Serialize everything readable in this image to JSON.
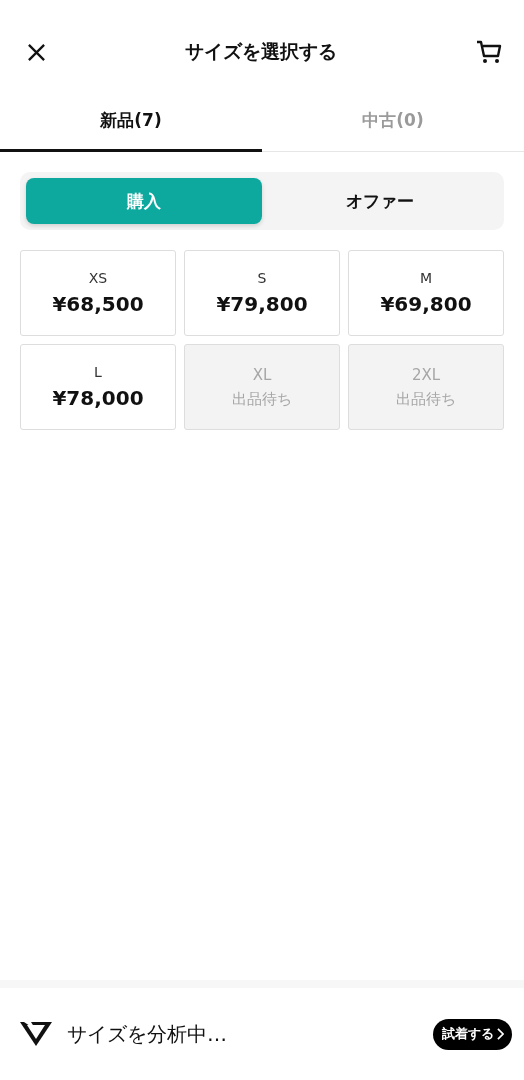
{
  "header": {
    "title": "サイズを選択する"
  },
  "tabs": [
    {
      "label": "新品(7)",
      "selected": true
    },
    {
      "label": "中古(0)",
      "selected": false
    }
  ],
  "mode_toggle": [
    {
      "label": "購入",
      "selected": true
    },
    {
      "label": "オファー",
      "selected": false
    }
  ],
  "sizes": [
    {
      "kind": "available",
      "size": "XS",
      "price": "¥68,500"
    },
    {
      "kind": "available",
      "size": "S",
      "price": "¥79,800"
    },
    {
      "kind": "available",
      "size": "M",
      "price": "¥69,800"
    },
    {
      "kind": "available",
      "size": "L",
      "price": "¥78,000"
    },
    {
      "kind": "unavailable",
      "size": "XL",
      "status": "出品待ち"
    },
    {
      "kind": "unavailable",
      "size": "2XL",
      "status": "出品待ち"
    }
  ],
  "footer": {
    "message": "サイズを分析中…",
    "button": "試着する"
  }
}
